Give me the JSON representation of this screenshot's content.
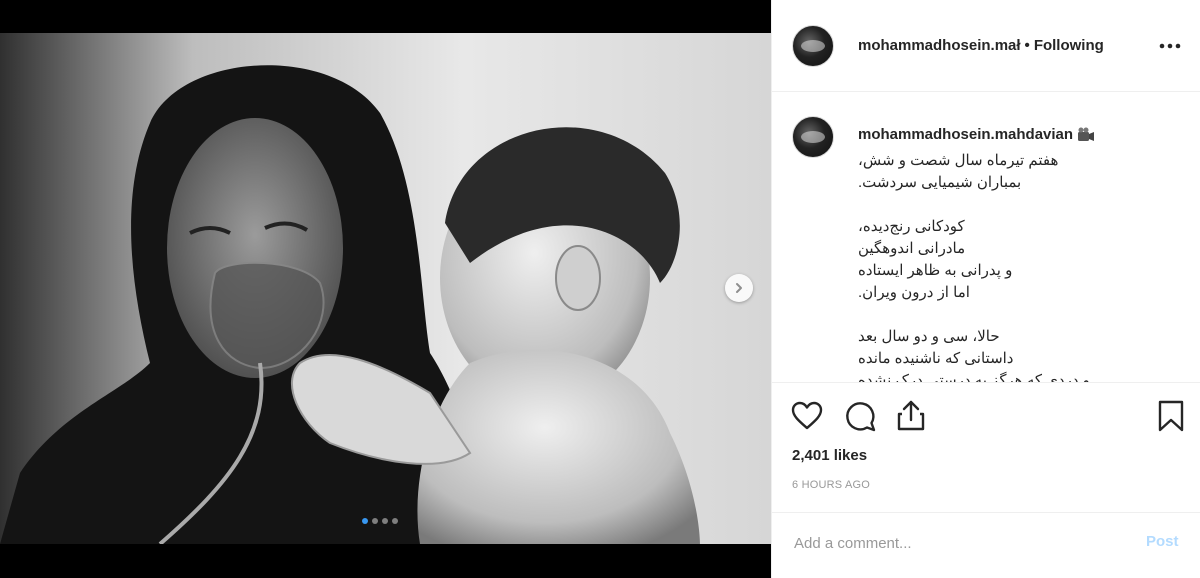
{
  "post": {
    "image_alt": "black-and-white photograph of a woman in a headscarf wearing an oxygen mask, holding a young child",
    "carousel": {
      "slide_count": 4,
      "active_index": 0
    }
  },
  "header": {
    "username": "mohammadhosein.mahdavian",
    "username_display": "mohammadhosein.mał",
    "separator": "•",
    "follow_status": "Following",
    "more_icon": "ellipsis-icon"
  },
  "caption": {
    "username": "mohammadhosein.mahdavian",
    "username_badge_icon": "film-camera-emoji-icon",
    "lines": [
      "هفتم تیرماه سال شصت و شش،",
      "بمباران شیمیایی سردشت.",
      "",
      "کودکانی رنج‌دیده،",
      "مادرانی اندوهگین",
      "و پدرانی به ظاهر ایستاده",
      "اما از درون ویران.",
      "",
      "حالا، سی و دو سال بعد",
      "داستانی که ناشنیده مانده",
      "و دردی که هرگز به درستی درک نشده"
    ]
  },
  "actions": {
    "like_icon": "heart-icon",
    "comment_icon": "comment-bubble-icon",
    "share_icon": "share-icon",
    "save_icon": "bookmark-icon"
  },
  "stats": {
    "likes": "2,401 likes",
    "time": "6 HOURS AGO"
  },
  "comment": {
    "placeholder": "Add a comment...",
    "post_label": "Post"
  },
  "colors": {
    "accent_blue": "#3897f0",
    "post_disabled": "#b3dbff",
    "text": "#262626",
    "muted": "#999999"
  }
}
